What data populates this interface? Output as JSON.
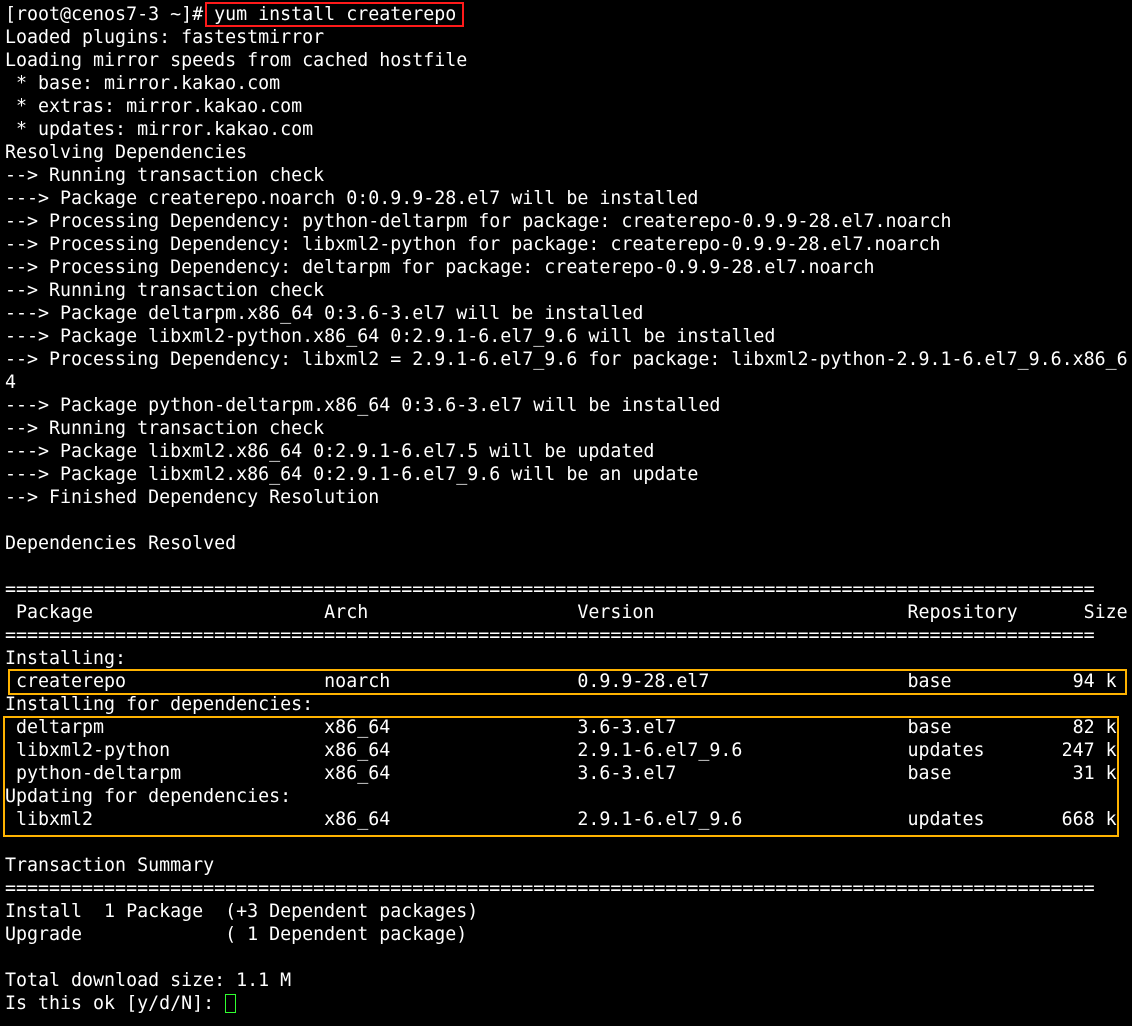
{
  "terminal": {
    "lines": [
      "[root@cenos7-3 ~]# yum install createrepo",
      "Loaded plugins: fastestmirror",
      "Loading mirror speeds from cached hostfile",
      " * base: mirror.kakao.com",
      " * extras: mirror.kakao.com",
      " * updates: mirror.kakao.com",
      "Resolving Dependencies",
      "--> Running transaction check",
      "---> Package createrepo.noarch 0:0.9.9-28.el7 will be installed",
      "--> Processing Dependency: python-deltarpm for package: createrepo-0.9.9-28.el7.noarch",
      "--> Processing Dependency: libxml2-python for package: createrepo-0.9.9-28.el7.noarch",
      "--> Processing Dependency: deltarpm for package: createrepo-0.9.9-28.el7.noarch",
      "--> Running transaction check",
      "---> Package deltarpm.x86_64 0:3.6-3.el7 will be installed",
      "---> Package libxml2-python.x86_64 0:2.9.1-6.el7_9.6 will be installed",
      "--> Processing Dependency: libxml2 = 2.9.1-6.el7_9.6 for package: libxml2-python-2.9.1-6.el7_9.6.x86_6",
      "4",
      "---> Package python-deltarpm.x86_64 0:3.6-3.el7 will be installed",
      "--> Running transaction check",
      "---> Package libxml2.x86_64 0:2.9.1-6.el7.5 will be updated",
      "---> Package libxml2.x86_64 0:2.9.1-6.el7_9.6 will be an update",
      "--> Finished Dependency Resolution",
      "",
      "Dependencies Resolved",
      "",
      "===================================================================================================",
      " Package                     Arch                   Version                       Repository      Size",
      "===================================================================================================",
      "Installing:",
      " createrepo                  noarch                 0.9.9-28.el7                  base           94 k",
      "Installing for dependencies:",
      " deltarpm                    x86_64                 3.6-3.el7                     base           82 k",
      " libxml2-python              x86_64                 2.9.1-6.el7_9.6               updates       247 k",
      " python-deltarpm             x86_64                 3.6-3.el7                     base           31 k",
      "Updating for dependencies:",
      " libxml2                     x86_64                 2.9.1-6.el7_9.6               updates       668 k",
      "",
      "Transaction Summary",
      "===================================================================================================",
      "Install  1 Package  (+3 Dependent packages)",
      "Upgrade             ( 1 Dependent package)",
      "",
      "Total download size: 1.1 M",
      "Is this ok [y/d/N]: "
    ]
  },
  "colors": {
    "background": "#000000",
    "text": "#ffffff",
    "command_highlight": "#ff1a1a",
    "package_highlight": "#ffb300",
    "cursor": "#2fff2f"
  }
}
